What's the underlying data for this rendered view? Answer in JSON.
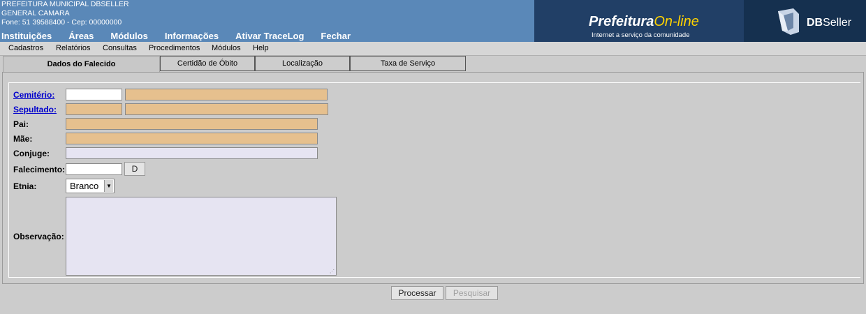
{
  "header": {
    "line1": "PREFEITURA MUNICIPAL DBSELLER",
    "line2": "GENERAL CAMARA",
    "line3": "Fone: 51 39588400  -  Cep: 00000000",
    "nav": [
      "Instituições",
      "Áreas",
      "Módulos",
      "Informações",
      "Ativar TraceLog",
      "Fechar"
    ],
    "logo": {
      "prefeitura": "Prefeitura",
      "online": "On-line",
      "tagline": "Internet a serviço da comunidade",
      "dbseller_bold": "DB",
      "dbseller_rest": "Seller"
    }
  },
  "menubar": [
    "Cadastros",
    "Relatórios",
    "Consultas",
    "Procedimentos",
    "Módulos",
    "Help"
  ],
  "tabs": [
    "Dados do Falecido",
    "Certidão de Óbito",
    "Localização",
    "Taxa de Serviço"
  ],
  "form": {
    "labels": {
      "cemiterio": "Cemitério:",
      "sepultado": "Sepultado:",
      "pai": "Pai:",
      "mae": "Mãe:",
      "conjuge": "Conjuge:",
      "falecimento": "Falecimento:",
      "etnia": "Etnia:",
      "observacao": "Observação:"
    },
    "date_button": "D",
    "etnia_value": "Branco"
  },
  "buttons": {
    "processar": "Processar",
    "pesquisar": "Pesquisar"
  },
  "colors": {
    "header_bg": "#5a88b8",
    "readonly_field": "#e6c08e",
    "optional_field": "#e6e4f2",
    "link": "#0000cc"
  }
}
